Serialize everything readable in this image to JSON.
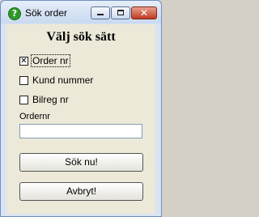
{
  "window": {
    "title": "Sök order",
    "icon": "question-icon",
    "close_glyph": "✕"
  },
  "dialog": {
    "heading": "Välj sök sätt",
    "options": [
      {
        "label": "Order nr",
        "checked": true,
        "mark": "✕"
      },
      {
        "label": "Kund nummer",
        "checked": false,
        "mark": ""
      },
      {
        "label": "Bilreg nr",
        "checked": false,
        "mark": ""
      }
    ],
    "field_label": "Ordernr",
    "field_value": "",
    "search_button": "Sök nu!",
    "cancel_button": "Avbryt!"
  },
  "colors": {
    "title_bar": "#d9e3f3",
    "client": "#ece9d8",
    "close_button": "#c0391f",
    "app_icon": "#2f9a28"
  }
}
